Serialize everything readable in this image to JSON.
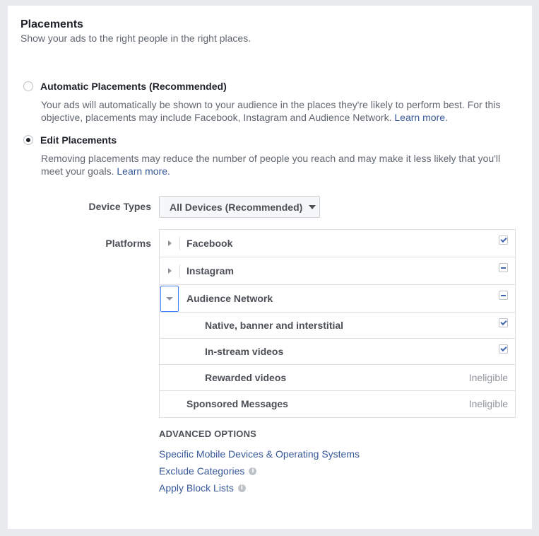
{
  "header": {
    "title": "Placements",
    "subtitle": "Show your ads to the right people in the right places."
  },
  "options": {
    "automatic": {
      "label": "Automatic Placements (Recommended)",
      "description": "Your ads will automatically be shown to your audience in the places they're likely to perform best. For this objective, placements may include Facebook, Instagram and Audience Network.",
      "link": "Learn more.",
      "selected": false
    },
    "edit": {
      "label": "Edit Placements",
      "description": "Removing placements may reduce the number of people you reach and may make it less likely that you'll meet your goals.",
      "link": "Learn more.",
      "selected": true
    }
  },
  "device_types": {
    "label": "Device Types",
    "value": "All Devices (Recommended)"
  },
  "platforms": {
    "label": "Platforms",
    "rows": [
      {
        "label": "Facebook",
        "state": "checked",
        "expander": "collapsed"
      },
      {
        "label": "Instagram",
        "state": "partial",
        "expander": "collapsed"
      },
      {
        "label": "Audience Network",
        "state": "partial",
        "expander": "expanded"
      },
      {
        "label": "Native, banner and interstitial",
        "state": "checked"
      },
      {
        "label": "In-stream videos",
        "state": "checked"
      },
      {
        "label": "Rewarded videos",
        "status": "Ineligible"
      },
      {
        "label": "Sponsored Messages",
        "status": "Ineligible"
      }
    ]
  },
  "advanced": {
    "title": "ADVANCED OPTIONS",
    "links": [
      {
        "label": "Specific Mobile Devices & Operating Systems",
        "info": false
      },
      {
        "label": "Exclude Categories",
        "info": true
      },
      {
        "label": "Apply Block Lists",
        "info": true
      }
    ],
    "info_glyph": "i"
  },
  "colors": {
    "link": "#365899",
    "checkbox_accent": "#4267b2",
    "page_background": "#e9eaed"
  }
}
